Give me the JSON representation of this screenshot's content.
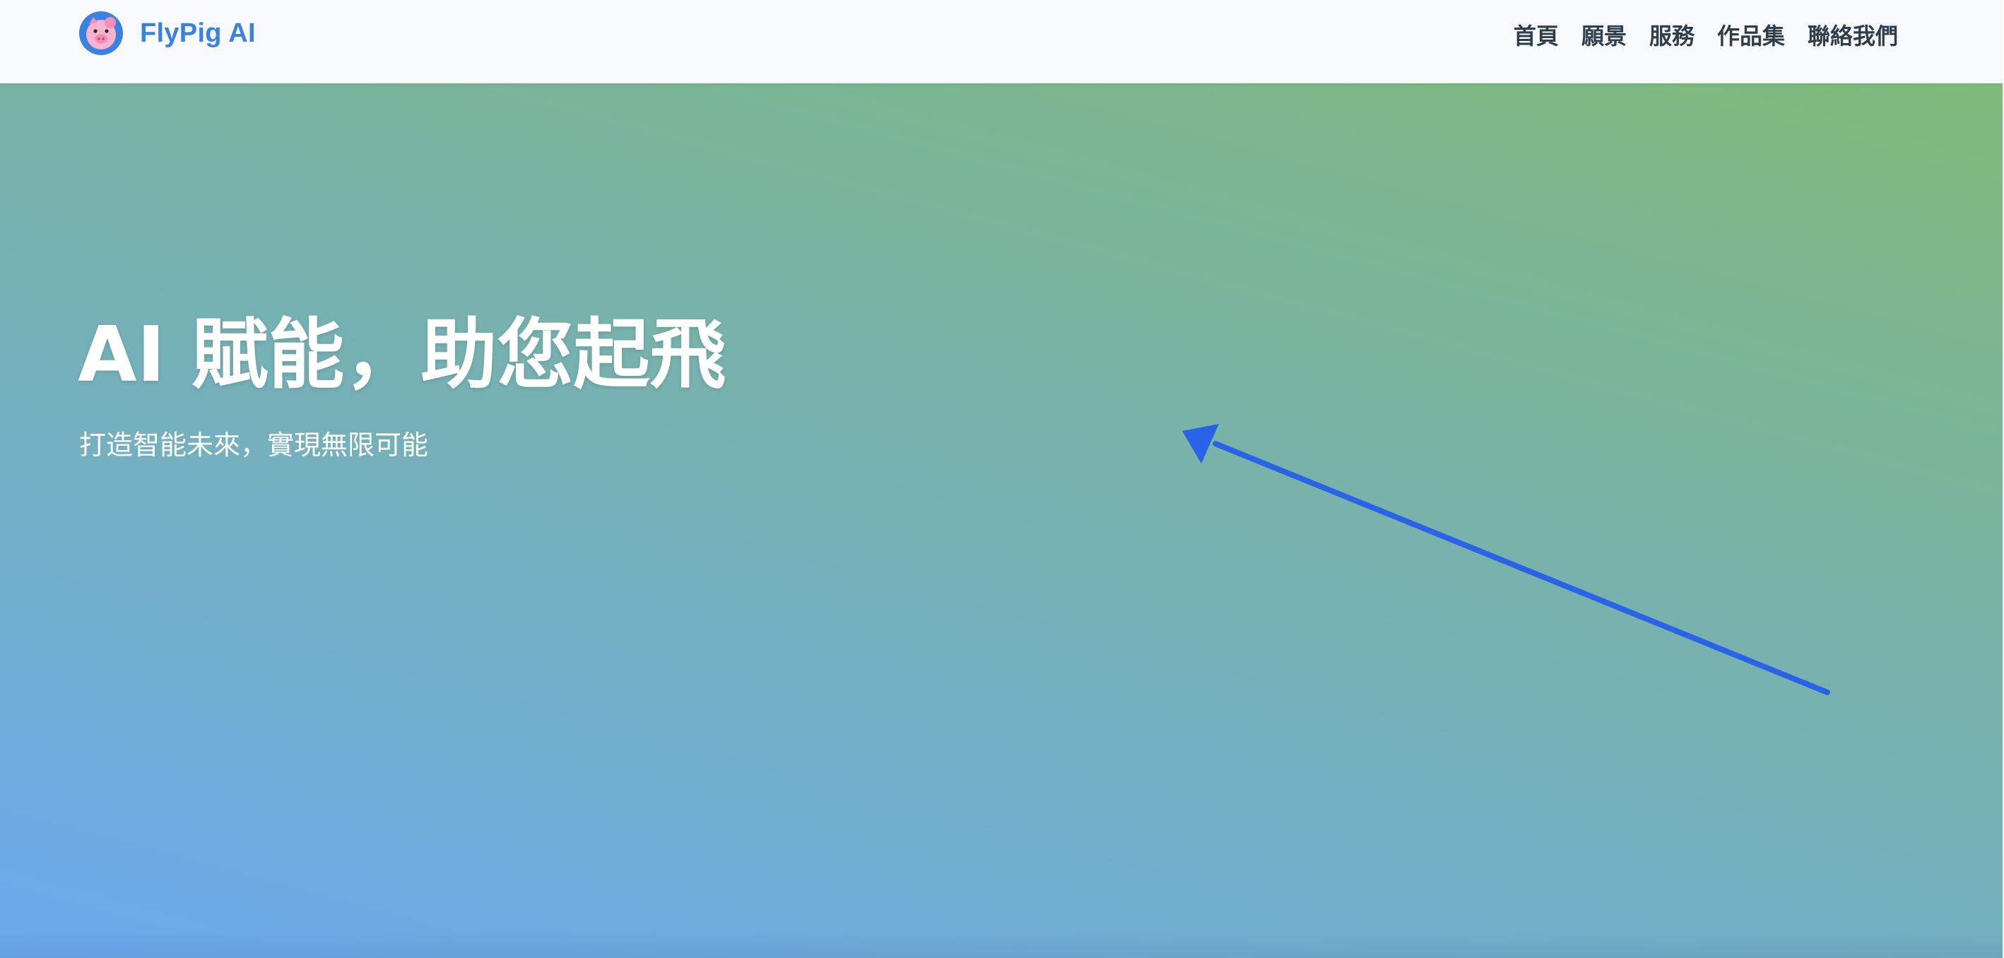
{
  "header": {
    "brand_name": "FlyPig AI",
    "logo_icon": "pig-face-icon",
    "nav": [
      {
        "label": "首頁"
      },
      {
        "label": "願景"
      },
      {
        "label": "服務"
      },
      {
        "label": "作品集"
      },
      {
        "label": "聯絡我們"
      }
    ]
  },
  "hero": {
    "title": "AI 賦能，助您起飛",
    "subtitle": "打造智能未來，實現無限可能"
  },
  "colors": {
    "brand": "#3b82e0",
    "nav_text": "#2f3e4c",
    "hero_gradient_start": "#6aa8ef",
    "hero_gradient_end": "#7fbb7a",
    "annotation_arrow": "#2a62e8"
  },
  "annotation": {
    "icon": "arrow-annotation-icon"
  }
}
